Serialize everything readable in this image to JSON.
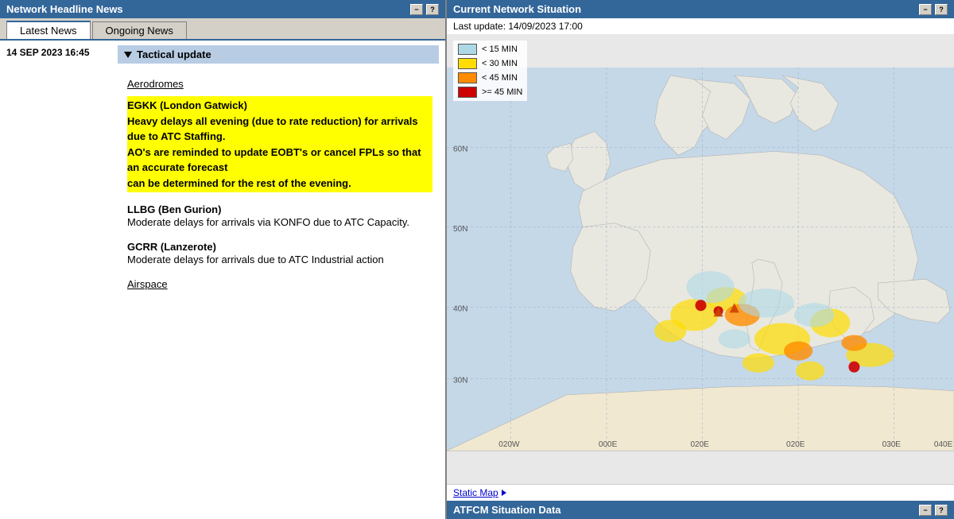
{
  "left_panel": {
    "title": "Network Headline News",
    "tabs": [
      {
        "id": "latest",
        "label": "Latest News",
        "active": true
      },
      {
        "id": "ongoing",
        "label": "Ongoing News",
        "active": false
      }
    ],
    "news_date": "14 SEP 2023 16:45",
    "news_type": "Tactical update",
    "sections": {
      "aerodromes_heading": "Aerodromes",
      "aerodromes": [
        {
          "id": "egkk",
          "name": "EGKK (London Gatwick)",
          "description": "Heavy delays all evening (due to rate reduction) for arrivals due to ATC Staffing.\nAO's are reminded to update EOBT's or cancel FPLs so that an accurate forecast\ncan be determined for the rest of the evening.",
          "highlight": true
        },
        {
          "id": "llbg",
          "name": "LLBG (Ben Gurion)",
          "description": "Moderate delays for arrivals via KONFO due to ATC Capacity.",
          "highlight": false
        },
        {
          "id": "gcrr",
          "name": "GCRR (Lanzerote)",
          "description": "Moderate delays for arrivals due to ATC Industrial action",
          "highlight": false
        }
      ],
      "airspace_heading": "Airspace"
    }
  },
  "right_panel": {
    "title": "Current Network Situation",
    "last_update_label": "Last update: 14/09/2023 17:00",
    "legend": [
      {
        "label": "< 15 MIN",
        "color": "#add8e6"
      },
      {
        "label": "< 30 MIN",
        "color": "#ffdd00"
      },
      {
        "label": "< 45 MIN",
        "color": "#ff8c00"
      },
      {
        "label": ">= 45 MIN",
        "color": "#cc0000"
      }
    ],
    "static_map_label": "Static Map",
    "bottom_title": "ATFCM Situation Data"
  },
  "win_controls": {
    "minimize": "−",
    "help": "?"
  }
}
